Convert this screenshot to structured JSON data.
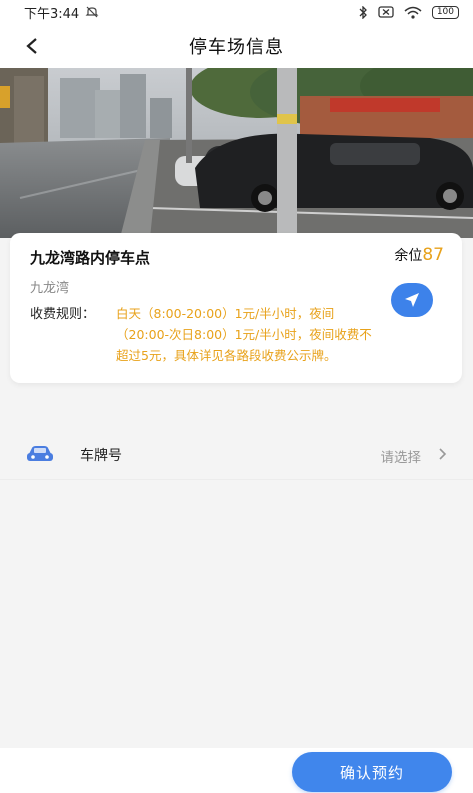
{
  "status_bar": {
    "time": "下午3:44",
    "battery": "100"
  },
  "header": {
    "title": "停车场信息"
  },
  "lot": {
    "name": "九龙湾路内停车点",
    "spots_label": "余位",
    "spots_count": "87",
    "area": "九龙湾",
    "rule_label": "收费规则：",
    "rule_text": "白天（8:00-20:00）1元/半小时，夜间（20:00-次日8:00）1元/半小时，夜间收费不超过5元，具体详见各路段收费公示牌。"
  },
  "plate": {
    "label": "车牌号",
    "placeholder": "请选择"
  },
  "actions": {
    "confirm_label": "确认预约"
  },
  "colors": {
    "accent": "#4086ec",
    "highlight": "#e8a21b"
  },
  "icons": [
    "mute-icon",
    "bluetooth-icon",
    "sim-icon",
    "wifi-icon",
    "battery-icon",
    "back-icon",
    "navigate-icon",
    "car-icon",
    "chevron-right-icon"
  ]
}
